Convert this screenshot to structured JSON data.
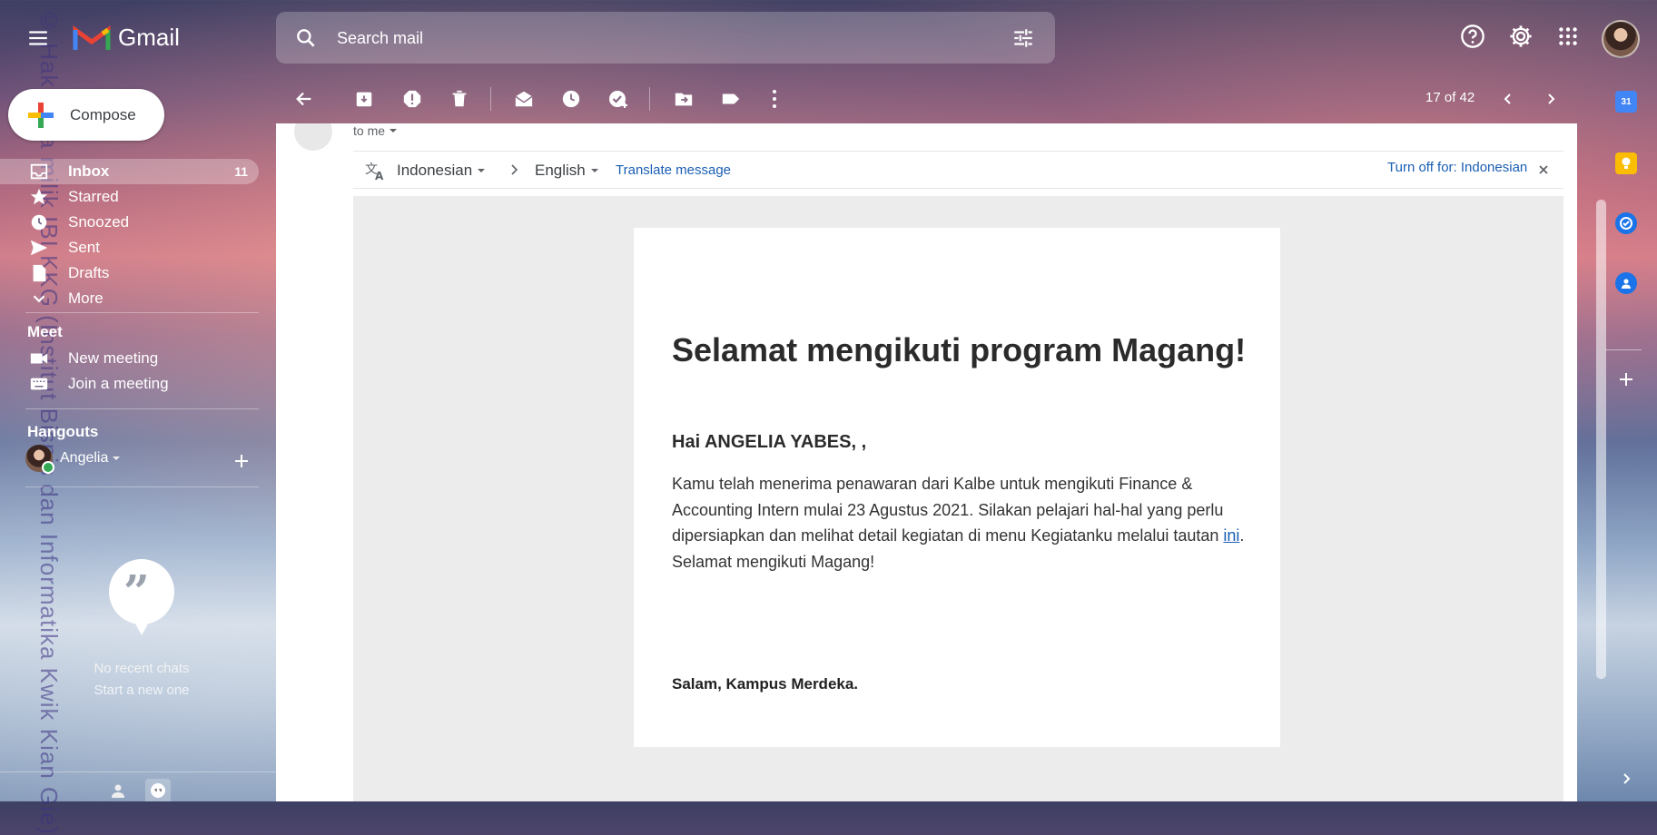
{
  "app": {
    "title": "Gmail"
  },
  "search": {
    "placeholder": "Search mail"
  },
  "compose": {
    "label": "Compose"
  },
  "nav": [
    {
      "label": "Inbox",
      "count": "11"
    },
    {
      "label": "Starred"
    },
    {
      "label": "Snoozed"
    },
    {
      "label": "Sent"
    },
    {
      "label": "Drafts"
    },
    {
      "label": "More"
    }
  ],
  "meet": {
    "title": "Meet",
    "items": [
      "New meeting",
      "Join a meeting"
    ]
  },
  "hangouts": {
    "title": "Hangouts",
    "user": "Angelia",
    "empty_title": "No recent chats",
    "empty_link": "Start a new one"
  },
  "toolbar": {
    "pager": "17 of 42"
  },
  "email": {
    "to_me": "to me",
    "translate": {
      "from": "Indonesian",
      "to": "English",
      "action": "Translate message",
      "turn_off": "Turn off for: Indonesian"
    },
    "title": "Selamat mengikuti program Magang!",
    "greeting": "Hai ANGELIA YABES, ,",
    "body_pre": "Kamu telah menerima penawaran dari Kalbe untuk mengikuti Finance & Accounting Intern mulai 23 Agustus 2021. Silakan pelajari hal-hal yang perlu dipersiapkan dan melihat detail kegiatan di menu Kegiatanku melalui tautan ",
    "body_link": "ini",
    "body_post": ". Selamat mengikuti Magang!",
    "signature": "Salam, Kampus Merdeka."
  },
  "watermark": "© Hak cipta milik IBI KKG (Institut Bisnis dan Informatika Kwik Kian Gie)",
  "colors": {
    "link": "#1a5fb4",
    "inbox_highlight": "rgba(255,255,255,0.28)"
  }
}
